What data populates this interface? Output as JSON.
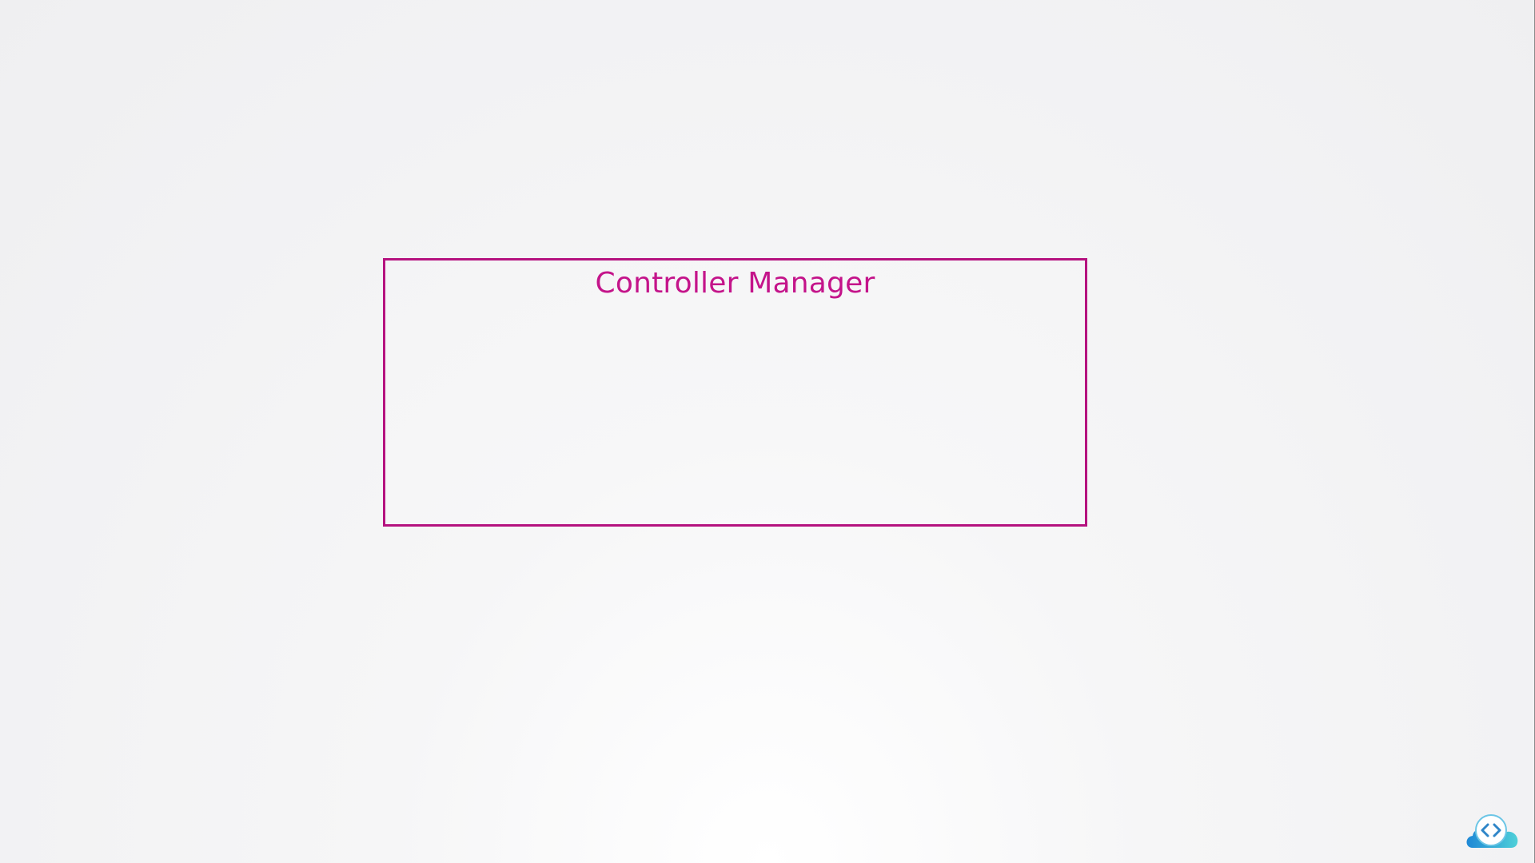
{
  "diagram": {
    "box": {
      "title": "Controller Manager",
      "border_color": "#b5127f",
      "title_color": "#c4148a"
    }
  },
  "branding": {
    "logo_icon": "cloud-code-logo-icon",
    "logo_colors": [
      "#1e88d6",
      "#4fd0d8"
    ]
  }
}
